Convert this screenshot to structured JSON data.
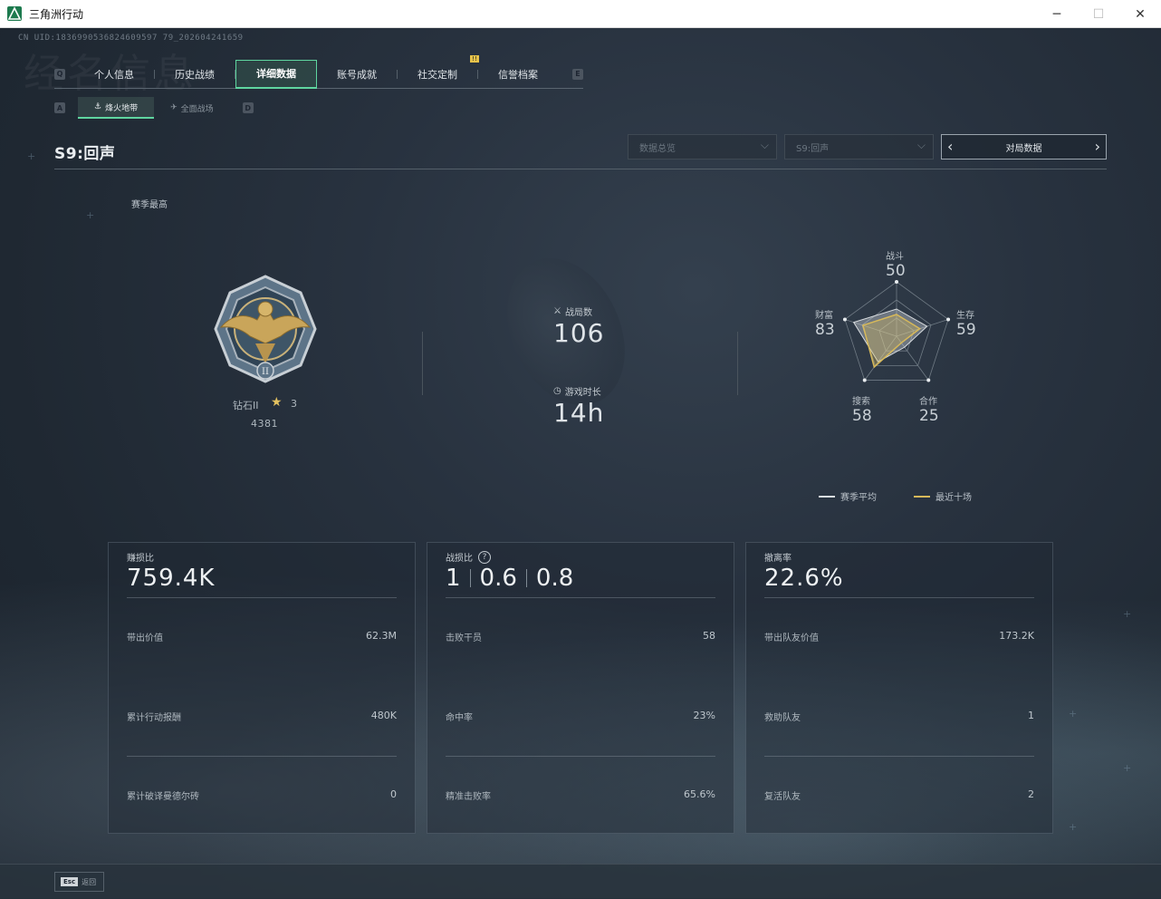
{
  "window": {
    "title": "三角洲行动",
    "minimize": "─",
    "maximize": "☐",
    "close": "✕"
  },
  "uid": "CN UID:1836990536824609597 79_202604241659",
  "ghost_text": "经名信息",
  "tabs": {
    "left_key": "Q",
    "right_key": "E",
    "items": [
      {
        "label": "个人信息"
      },
      {
        "label": "历史战绩"
      },
      {
        "label": "详细数据",
        "active": true
      },
      {
        "label": "账号成就"
      },
      {
        "label": "社交定制"
      },
      {
        "label": "信誉档案"
      }
    ],
    "badge": "!!"
  },
  "subtabs": {
    "left_key": "A",
    "right_key": "D",
    "items": [
      {
        "label": "烽火地带",
        "icon": "⚓",
        "active": true
      },
      {
        "label": "全面战场",
        "icon": "✈",
        "active": false
      }
    ]
  },
  "season_title": "S9:回声",
  "filters": {
    "category": "数据总览",
    "season": "S9:回声",
    "pager_label": "对局数据",
    "prev": "‹",
    "next": "›"
  },
  "season_best": {
    "label": "赛季最高",
    "rank_name": "钻石II",
    "stars": "3",
    "score": "4381"
  },
  "stats": {
    "matches_label": "战局数",
    "matches_value": "106",
    "time_label": "游戏时长",
    "time_value": "14h"
  },
  "radar": {
    "axes": [
      {
        "label": "战斗",
        "value": "50"
      },
      {
        "label": "生存",
        "value": "59"
      },
      {
        "label": "合作",
        "value": "25"
      },
      {
        "label": "搜索",
        "value": "58"
      },
      {
        "label": "财富",
        "value": "83"
      }
    ],
    "season_avg": [
      50,
      59,
      25,
      58,
      83
    ],
    "recent_ten": [
      40,
      45,
      15,
      70,
      65
    ],
    "colors": {
      "season_avg": "#d9dde0",
      "recent_ten": "#d7b95a"
    },
    "legend": {
      "season_avg": "赛季平均",
      "recent_ten": "最近十场"
    }
  },
  "cards": [
    {
      "title": "赚损比",
      "big": "759.4K",
      "rows": [
        {
          "k": "带出价值",
          "v": "62.3M"
        },
        {
          "k": "累计行动报酬",
          "v": "480K"
        },
        {
          "k": "累计破译曼德尔砖",
          "v": "0"
        }
      ]
    },
    {
      "title": "战损比",
      "help": "?",
      "big_parts": [
        "1",
        "0.6",
        "0.8"
      ],
      "rows": [
        {
          "k": "击败干员",
          "v": "58"
        },
        {
          "k": "命中率",
          "v": "23%"
        },
        {
          "k": "精准击败率",
          "v": "65.6%"
        }
      ]
    },
    {
      "title": "撤离率",
      "big": "22.6%",
      "rows": [
        {
          "k": "带出队友价值",
          "v": "173.2K"
        },
        {
          "k": "救助队友",
          "v": "1"
        },
        {
          "k": "复活队友",
          "v": "2"
        }
      ]
    }
  ],
  "bottom": {
    "esc_key": "Esc",
    "back_label": "返回"
  }
}
